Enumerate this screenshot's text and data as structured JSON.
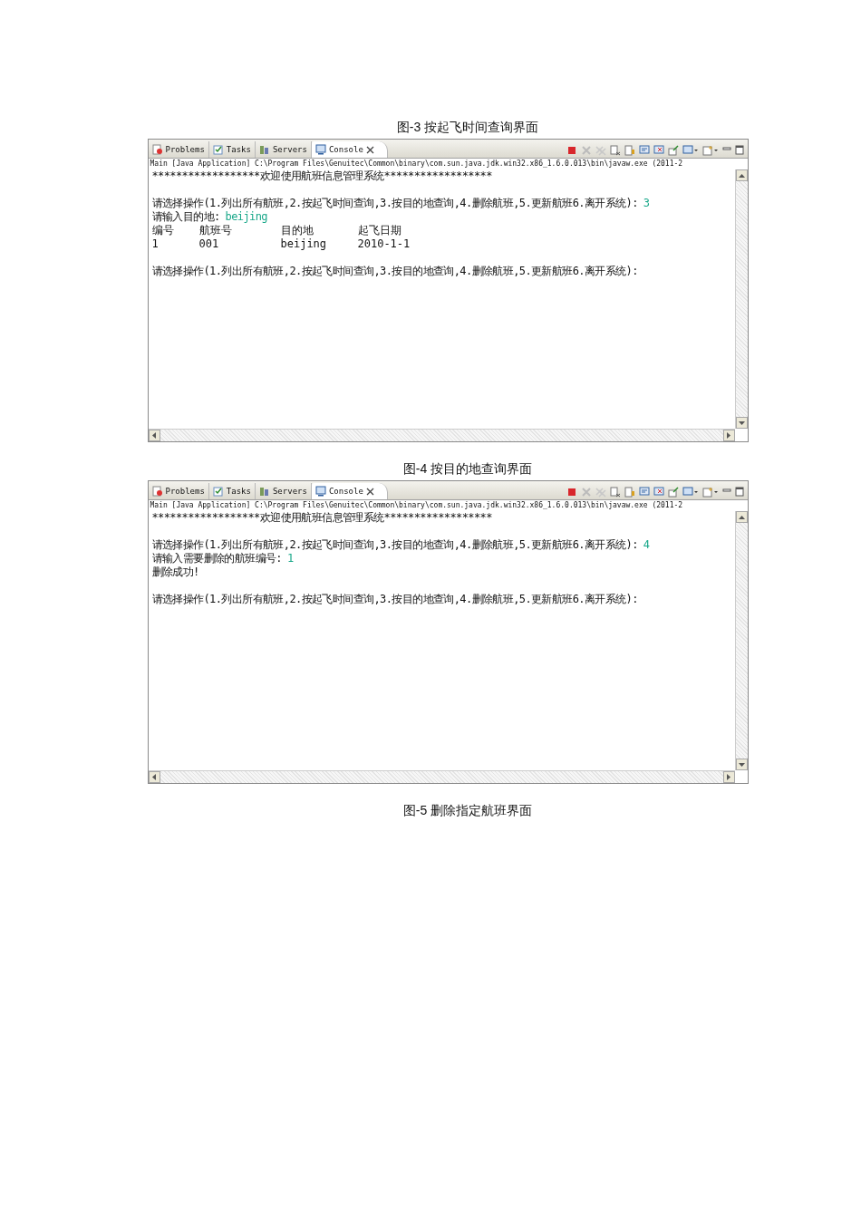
{
  "blocks": [
    {
      "kind": "caption",
      "text": "图-3 按起飞时间查询界面"
    },
    {
      "kind": "console",
      "tabs": [
        {
          "label": "Problems",
          "selected": false
        },
        {
          "label": "Tasks",
          "selected": false
        },
        {
          "label": "Servers",
          "selected": false
        },
        {
          "label": "Console",
          "selected": true
        }
      ],
      "launch_line": "Main [Java Application] C:\\Program Files\\Genuitec\\Common\\binary\\com.sun.java.jdk.win32.x86_1.6.0.013\\bin\\javaw.exe  (2011-2",
      "lines": [
        {
          "kind": "text",
          "segments": [
            {
              "kind": "output",
              "text": "******************欢迎使用航班信息管理系统******************"
            }
          ]
        },
        {
          "kind": "blank"
        },
        {
          "kind": "text",
          "segments": [
            {
              "kind": "output",
              "text": "请选择操作(1.列出所有航班,2.按起飞时间查询,3.按目的地查询,4.删除航班,5.更新航班6.离开系统):"
            },
            {
              "kind": "input",
              "text": "3"
            }
          ]
        },
        {
          "kind": "text",
          "segments": [
            {
              "kind": "output",
              "text": "请输入目的地:"
            },
            {
              "kind": "input",
              "text": "beijing"
            }
          ]
        },
        {
          "kind": "row",
          "cells": [
            "编号",
            "航班号",
            "目的地",
            "起飞日期"
          ]
        },
        {
          "kind": "row",
          "cells": [
            "1",
            "001",
            "beijing",
            "2010-1-1"
          ]
        },
        {
          "kind": "blank"
        },
        {
          "kind": "text",
          "segments": [
            {
              "kind": "output",
              "text": "请选择操作(1.列出所有航班,2.按起飞时间查询,3.按目的地查询,4.删除航班,5.更新航班6.离开系统):"
            }
          ]
        }
      ]
    },
    {
      "kind": "caption",
      "text": "图-4 按目的地查询界面"
    },
    {
      "kind": "console",
      "tabs": [
        {
          "label": "Problems",
          "selected": false
        },
        {
          "label": "Tasks",
          "selected": false
        },
        {
          "label": "Servers",
          "selected": false
        },
        {
          "label": "Console",
          "selected": true
        }
      ],
      "launch_line": "Main [Java Application] C:\\Program Files\\Genuitec\\Common\\binary\\com.sun.java.jdk.win32.x86_1.6.0.013\\bin\\javaw.exe  (2011-2",
      "lines": [
        {
          "kind": "text",
          "segments": [
            {
              "kind": "output",
              "text": "******************欢迎使用航班信息管理系统******************"
            }
          ]
        },
        {
          "kind": "blank"
        },
        {
          "kind": "text",
          "segments": [
            {
              "kind": "output",
              "text": "请选择操作(1.列出所有航班,2.按起飞时间查询,3.按目的地查询,4.删除航班,5.更新航班6.离开系统):"
            },
            {
              "kind": "input",
              "text": "4"
            }
          ]
        },
        {
          "kind": "text",
          "segments": [
            {
              "kind": "output",
              "text": "请输入需要删除的航班编号:"
            },
            {
              "kind": "input",
              "text": "1"
            }
          ]
        },
        {
          "kind": "text",
          "segments": [
            {
              "kind": "output",
              "text": "删除成功!"
            }
          ]
        },
        {
          "kind": "blank"
        },
        {
          "kind": "text",
          "segments": [
            {
              "kind": "output",
              "text": "请选择操作(1.列出所有航班,2.按起飞时间查询,3.按目的地查询,4.删除航班,5.更新航班6.离开系统):"
            }
          ]
        }
      ]
    },
    {
      "kind": "caption",
      "text": "图-5 删除指定航班界面"
    }
  ]
}
